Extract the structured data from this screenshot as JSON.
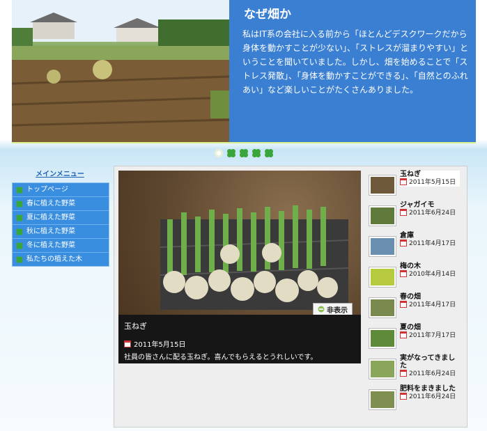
{
  "header": {
    "title": "なぜ畑か",
    "body": "私はIT系の会社に入る前から「ほとんどデスクワークだから身体を動かすことが少ない」、「ストレスが溜まりやすい」ということを聞いていました。しかし、畑を始めることで「ストレス発散」、「身体を動かすことができる」、「自然とのふれあい」など楽しいことがたくさんありました。"
  },
  "menu": {
    "title": "メインメニュー",
    "items": [
      {
        "label": "トップページ"
      },
      {
        "label": "春に植えた野菜"
      },
      {
        "label": "夏に植えた野菜"
      },
      {
        "label": "秋に植えた野菜"
      },
      {
        "label": "冬に植えた野菜"
      },
      {
        "label": "私たちの植えた木"
      }
    ]
  },
  "feature": {
    "hide_label": "非表示",
    "title": "玉ねぎ",
    "date": "2011年5月15日",
    "desc": "社員の皆さんに配る玉ねぎ。喜んでもらえるとうれしいです。"
  },
  "thumbs": [
    {
      "title": "玉ねぎ",
      "date": "2011年5月15日",
      "color": "#6e5a3a"
    },
    {
      "title": "ジャガイモ",
      "date": "2011年6月24日",
      "color": "#5f7a3a"
    },
    {
      "title": "倉庫",
      "date": "2011年4月17日",
      "color": "#6b8fb0"
    },
    {
      "title": "梅の木",
      "date": "2010年4月14日",
      "color": "#b7c93e"
    },
    {
      "title": "春の畑",
      "date": "2011年4月17日",
      "color": "#7a8a4e"
    },
    {
      "title": "夏の畑",
      "date": "2011年7月17日",
      "color": "#5f8a3a"
    },
    {
      "title": "実がなってきました",
      "date": "2011年6月24日",
      "color": "#8aa65a"
    },
    {
      "title": "肥料をまきました",
      "date": "2011年6月24日",
      "color": "#7f8f52"
    }
  ],
  "colors": {
    "accent": "#3b7fd3",
    "menu": "#3a8ee0",
    "clover": "#3aa53a"
  }
}
